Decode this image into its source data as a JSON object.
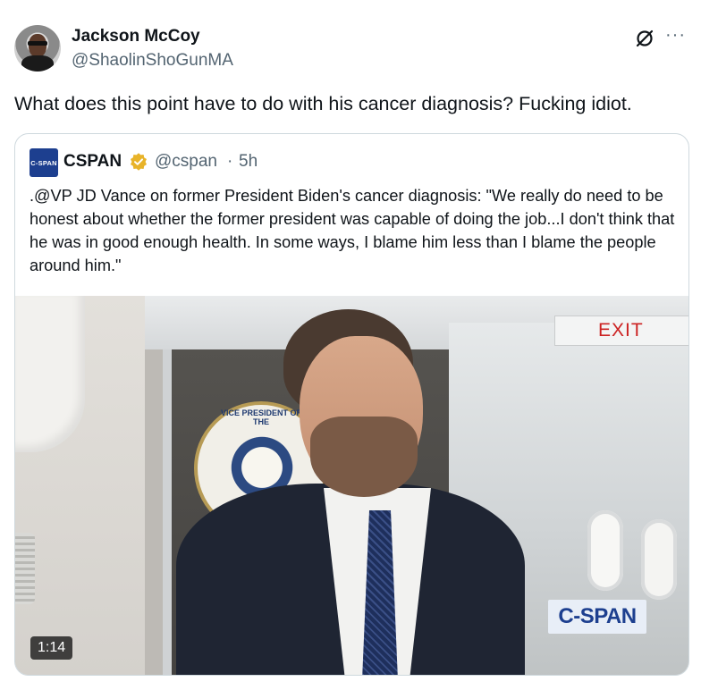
{
  "author": {
    "display_name": "Jackson McCoy",
    "handle": "@ShaolinShoGunMA"
  },
  "icons": [
    "grok-icon",
    "more-icon",
    "verified-gold-badge-icon"
  ],
  "tweet": {
    "text": "What does this point have to do with his cancer diagnosis? Fucking idiot.",
    "more_label": "···"
  },
  "quoted": {
    "logo_text": "C-SPAN",
    "name": "CSPAN",
    "handle": "@cspan",
    "separator": "·",
    "time": "5h",
    "text": ".@VP JD Vance on former President Biden's cancer diagnosis: \"We really do need to be honest about whether the former president was capable of doing the job...I don't think that he was in good enough health. In some ways, I blame him less than I blame the people around him.\"",
    "media": {
      "exit_sign": "EXIT",
      "seal_text": "VICE PRESIDENT OF THE",
      "watermark": "C-SPAN",
      "duration": "1:14"
    }
  },
  "colors": {
    "text_primary": "#0f1419",
    "text_secondary": "#536471",
    "border": "#cfd9de",
    "cspan_blue": "#1d3f8f",
    "verified_gold": "#e8b329"
  }
}
